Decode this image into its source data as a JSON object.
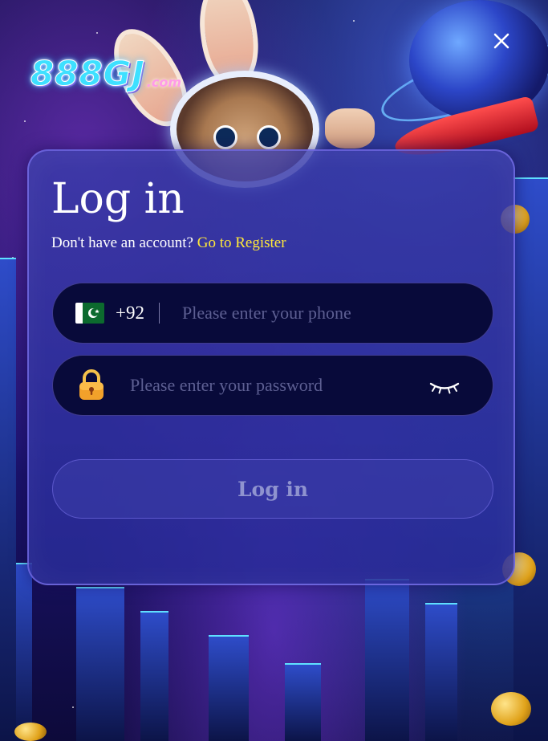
{
  "logo": {
    "main": "888GJ",
    "sub": ".com"
  },
  "title": "Log in",
  "signup_prompt": {
    "text": "Don't have an account? ",
    "link": "Go to Register"
  },
  "phone": {
    "country_flag": "pakistan-flag",
    "country_code": "+92",
    "placeholder": "Please enter your phone"
  },
  "password": {
    "placeholder": "Please enter your password",
    "lock_icon": "lock-icon",
    "visibility_icon": "closed-eye-icon"
  },
  "login_button": "Log in",
  "colors": {
    "accent_link": "#ffe83a",
    "field_bg": "#080a3a",
    "panel_bg": "#3a3caa"
  }
}
